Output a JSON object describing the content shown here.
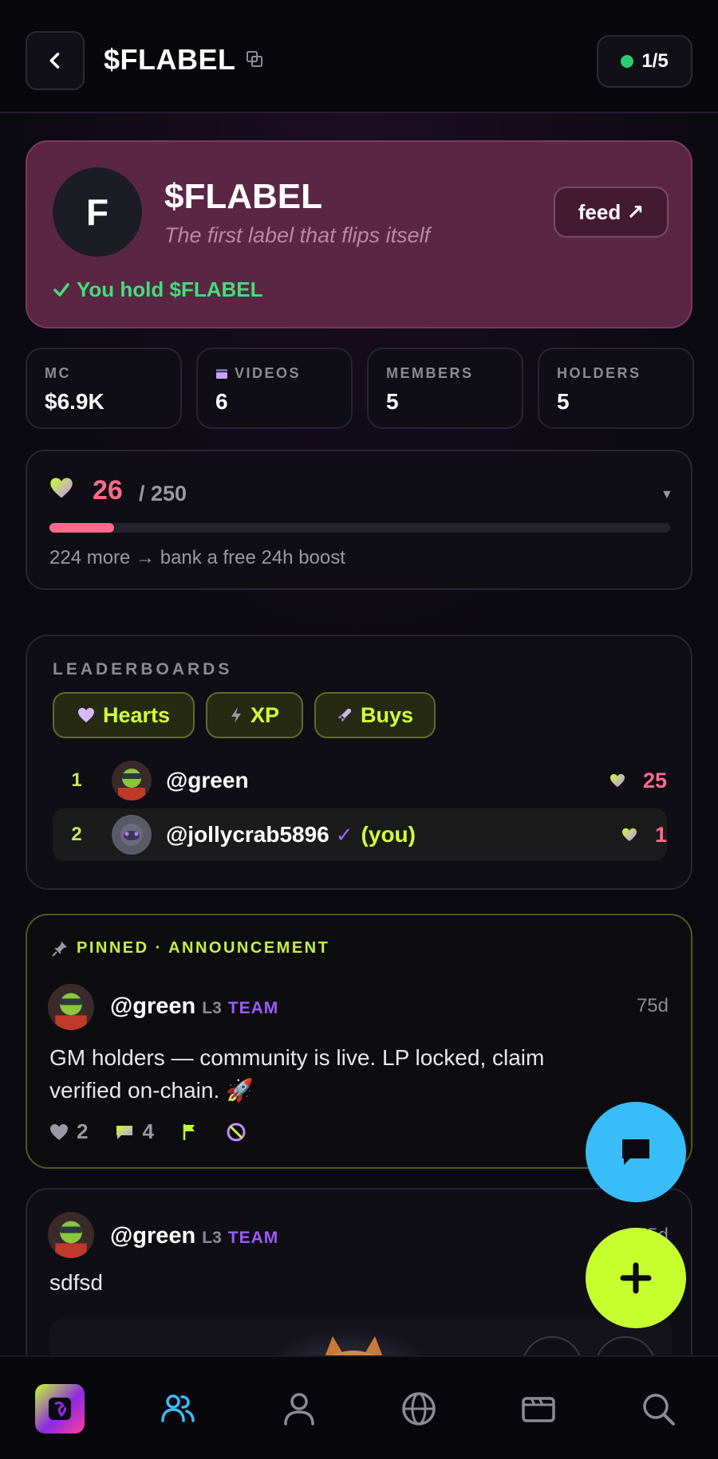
{
  "header": {
    "title": "$FLABEL",
    "page_indicator": "1/5"
  },
  "hero": {
    "avatar_letter": "F",
    "title": "$FLABEL",
    "tagline": "The first label that flips itself",
    "feed_button": "feed ↗",
    "hold_status": "You hold $FLABEL"
  },
  "stats": [
    {
      "label": "MC",
      "value": "$6.9K"
    },
    {
      "label": "VIDEOS",
      "value": "6"
    },
    {
      "label": "MEMBERS",
      "value": "5"
    },
    {
      "label": "HOLDERS",
      "value": "5"
    }
  ],
  "hearts_progress": {
    "count": "26",
    "total": "/ 250",
    "fraction": 0.104,
    "hint": "224 more → bank a free 24h boost"
  },
  "leaderboards": {
    "title": "LEADERBOARDS",
    "tabs": [
      {
        "label": "Hearts",
        "icon": "heart-icon"
      },
      {
        "label": "XP",
        "icon": "bolt-icon"
      },
      {
        "label": "Buys",
        "icon": "rocket-icon"
      }
    ],
    "rows": [
      {
        "rank": "1",
        "user": "@green",
        "score": "25",
        "you": ""
      },
      {
        "rank": "2",
        "user": "@jollycrab5896",
        "score": "1",
        "you": "(you)"
      }
    ]
  },
  "pinned_post": {
    "label": "PINNED · ANNOUNCEMENT",
    "author": "@green",
    "level": "L3",
    "team": "TEAM",
    "time": "75d",
    "body": "GM holders — community is live. LP locked, claim verified on-chain. 🚀",
    "likes": "2",
    "comments": "4"
  },
  "post": {
    "author": "@green",
    "level": "L3",
    "team": "TEAM",
    "time": "75d",
    "body": "sdfsd"
  },
  "colors": {
    "hero_bg": "#5b2644",
    "accent_lime": "#c6ff2e",
    "accent_pink": "#ff6b8a",
    "accent_blue": "#38bdf8",
    "team_purple": "#9b5cff"
  },
  "nav": [
    "app-logo",
    "community-icon",
    "profile-icon",
    "globe-icon",
    "folder-icon",
    "search-icon"
  ]
}
